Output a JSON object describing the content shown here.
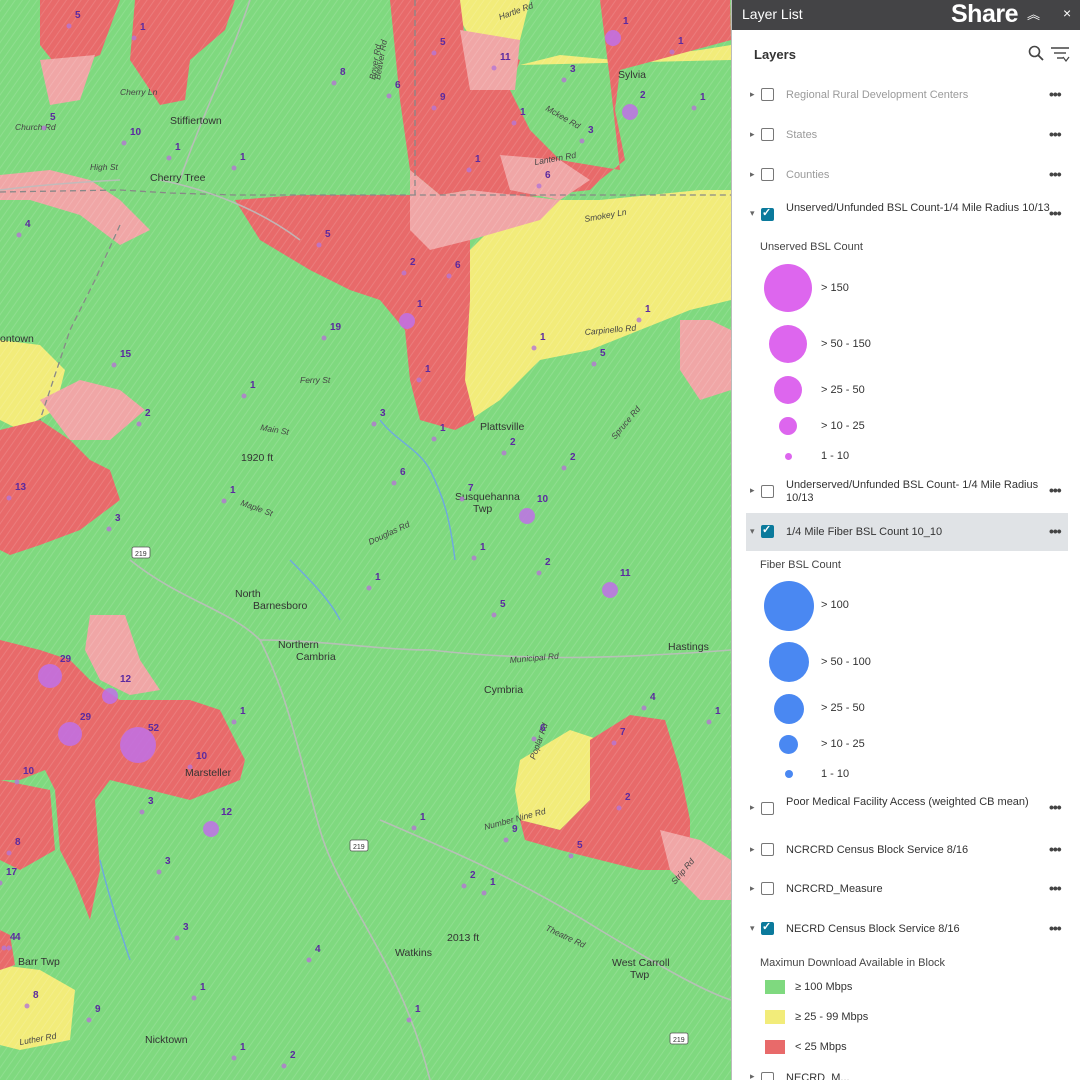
{
  "panel": {
    "title": "Layer List",
    "share_label": "Share",
    "close_glyph": "×",
    "layers_label": "Layers",
    "icons": [
      "search-icon",
      "filter-icon",
      "chevron-up-icon",
      "close-icon"
    ]
  },
  "layers": [
    {
      "label": "Regional Rural Development Centers",
      "checked": false,
      "expanded": false
    },
    {
      "label": "States",
      "checked": false,
      "expanded": false
    },
    {
      "label": "Counties",
      "checked": false,
      "expanded": false
    },
    {
      "label": "Unserved/Unfunded BSL Count-1/4 Mile Radius 10/13",
      "checked": true,
      "expanded": true
    },
    {
      "label": "Underserved/Unfunded BSL Count- 1/4 Mile Radius 10/13",
      "checked": false,
      "expanded": false
    },
    {
      "label": "1/4 Mile Fiber BSL Count 10_10",
      "checked": true,
      "expanded": true
    },
    {
      "label": "Poor Medical Facility Access (weighted CB mean)",
      "checked": false,
      "expanded": false
    },
    {
      "label": "NCRCRD Census Block Service 8/16",
      "checked": false,
      "expanded": false
    },
    {
      "label": "NCRCRD_Measure",
      "checked": false,
      "expanded": false
    },
    {
      "label": "NECRD Census Block Service 8/16",
      "checked": true,
      "expanded": true
    },
    {
      "label": "NECRD_M...",
      "checked": false,
      "expanded": false
    }
  ],
  "more_glyph": "•••",
  "legends": {
    "unserved": {
      "title": "Unserved BSL Count",
      "color": "#dd66ee",
      "classes": [
        "> 150",
        "> 50 - 150",
        "> 25 - 50",
        "> 10 - 25",
        "1 - 10"
      ]
    },
    "fiber": {
      "title": "Fiber BSL Count",
      "color": "#4a88f2",
      "classes": [
        "> 100",
        "> 50 - 100",
        "> 25 - 50",
        "> 10 - 25",
        "1 - 10"
      ]
    },
    "download": {
      "title": "Maximun Download Available in Block",
      "classes": [
        {
          "label": "≥ 100 Mbps",
          "color": "#7fd97f"
        },
        {
          "label": "≥ 25 - 99 Mbps",
          "color": "#f2ec7a"
        },
        {
          "label": "< 25 Mbps",
          "color": "#e86a6a"
        }
      ]
    }
  },
  "map": {
    "colors": {
      "green": "#7fd97f",
      "yellow": "#f2ec7a",
      "red": "#e86a6a",
      "pink": "#f0a6a6",
      "dot_purple": "#c070e8"
    },
    "towns": [
      "Stiffiertown",
      "Cherry Tree",
      "Plattsville",
      "Susquehanna Twp",
      "North Barnesboro",
      "Northern Cambria",
      "Cymbria",
      "Hastings",
      "Marsteller",
      "Barr Twp",
      "Watkins",
      "West Carroll Twp",
      "Nicktown",
      "Sylvia",
      "ontown",
      "1920 ft",
      "2013 ft"
    ],
    "roads": [
      "Cherry Ln",
      "High St",
      "Church Rd",
      "Smokey Ln",
      "Carpinello Rd",
      "Ferry St",
      "Main St",
      "Maple St",
      "Douglas Rd",
      "Municipal Rd",
      "Poplar Rd",
      "Theatre Rd",
      "Luther Rd",
      "Number Nine Rd",
      "Strip Rd",
      "Boyer Rd",
      "Mckee Rd",
      "Hartle Rd",
      "Lantern Rd",
      "Spruce Rd",
      "Beaver Rd"
    ],
    "counts": [
      "5",
      "1",
      "5",
      "6",
      "1",
      "1",
      "5",
      "8",
      "11",
      "9",
      "10",
      "1",
      "1",
      "3",
      "1",
      "3",
      "2",
      "1",
      "1",
      "6",
      "4",
      "5",
      "2",
      "6",
      "19",
      "1",
      "1",
      "1",
      "1",
      "15",
      "5",
      "1",
      "2",
      "3",
      "1",
      "2",
      "6",
      "7",
      "10",
      "13",
      "2",
      "1",
      "3",
      "1",
      "5",
      "2",
      "11",
      "29",
      "12",
      "29",
      "52",
      "10",
      "3",
      "12",
      "10",
      "8",
      "4",
      "2",
      "7",
      "5",
      "9",
      "6",
      "3",
      "2",
      "1",
      "17",
      "4",
      "1",
      "8",
      "9",
      "1",
      "3",
      "1",
      "1",
      "4",
      "1",
      "2",
      "1",
      "1",
      "4"
    ]
  }
}
